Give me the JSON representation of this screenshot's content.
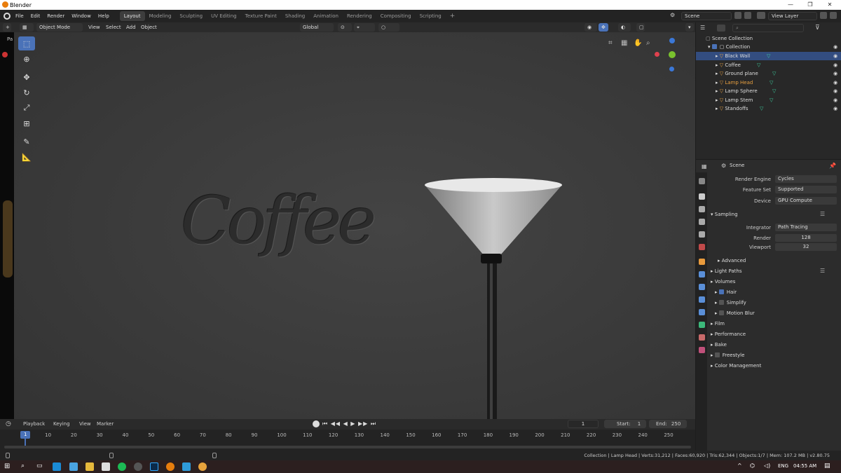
{
  "window": {
    "title": "Blender"
  },
  "menu": [
    "File",
    "Edit",
    "Render",
    "Window",
    "Help"
  ],
  "workspaces": [
    "Layout",
    "Modeling",
    "Sculpting",
    "UV Editing",
    "Texture Paint",
    "Shading",
    "Animation",
    "Rendering",
    "Compositing",
    "Scripting"
  ],
  "scene_field": "Scene",
  "viewlayer_field": "View Layer",
  "viewport_header": {
    "mode": "Object Mode",
    "view": "View",
    "select": "Select",
    "add": "Add",
    "object": "Object",
    "orientation": "Global"
  },
  "neon_text": "Coffee",
  "left_strip_label": "Pa",
  "outliner": {
    "root": "Scene Collection",
    "collection": "Collection",
    "items": [
      {
        "label": "Black Wall"
      },
      {
        "label": "Coffee"
      },
      {
        "label": "Ground plane"
      },
      {
        "label": "Lamp Head"
      },
      {
        "label": "Lamp Sphere"
      },
      {
        "label": "Lamp Stem"
      },
      {
        "label": "Standoffs"
      }
    ]
  },
  "properties": {
    "header": "Scene",
    "render_engine_label": "Render Engine",
    "render_engine": "Cycles",
    "feature_set_label": "Feature Set",
    "feature_set": "Supported",
    "device_label": "Device",
    "device": "GPU Compute",
    "sampling": "Sampling",
    "integrator_label": "Integrator",
    "integrator": "Path Tracing",
    "render_label": "Render",
    "render_samples": "128",
    "viewport_label": "Viewport",
    "viewport_samples": "32",
    "sections": [
      "Advanced",
      "Light Paths",
      "Volumes",
      "Hair",
      "Simplify",
      "Motion Blur",
      "Film",
      "Performance",
      "Bake",
      "Freestyle",
      "Color Management"
    ]
  },
  "timeline": {
    "playback": "Playback",
    "keying": "Keying",
    "view": "View",
    "marker": "Marker",
    "current_frame": "1",
    "start_label": "Start:",
    "start": "1",
    "end_label": "End:",
    "end": "250",
    "ticks": [
      "1",
      "10",
      "20",
      "30",
      "40",
      "50",
      "60",
      "70",
      "80",
      "90",
      "100",
      "110",
      "120",
      "130",
      "140",
      "150",
      "160",
      "170",
      "180",
      "190",
      "200",
      "210",
      "220",
      "230",
      "240",
      "250"
    ]
  },
  "status": "Collection | Lamp Head | Verts:31,212 | Faces:60,920 | Tris:62,344 | Objects:1/7 | Mem: 107.2 MB | v2.80.75",
  "taskbar": {
    "lang": "ENG",
    "time": "04:55 AM"
  },
  "colors": {
    "accent": "#4a72b8",
    "selected_row": "#334d80",
    "active_object": "#e8a040"
  }
}
